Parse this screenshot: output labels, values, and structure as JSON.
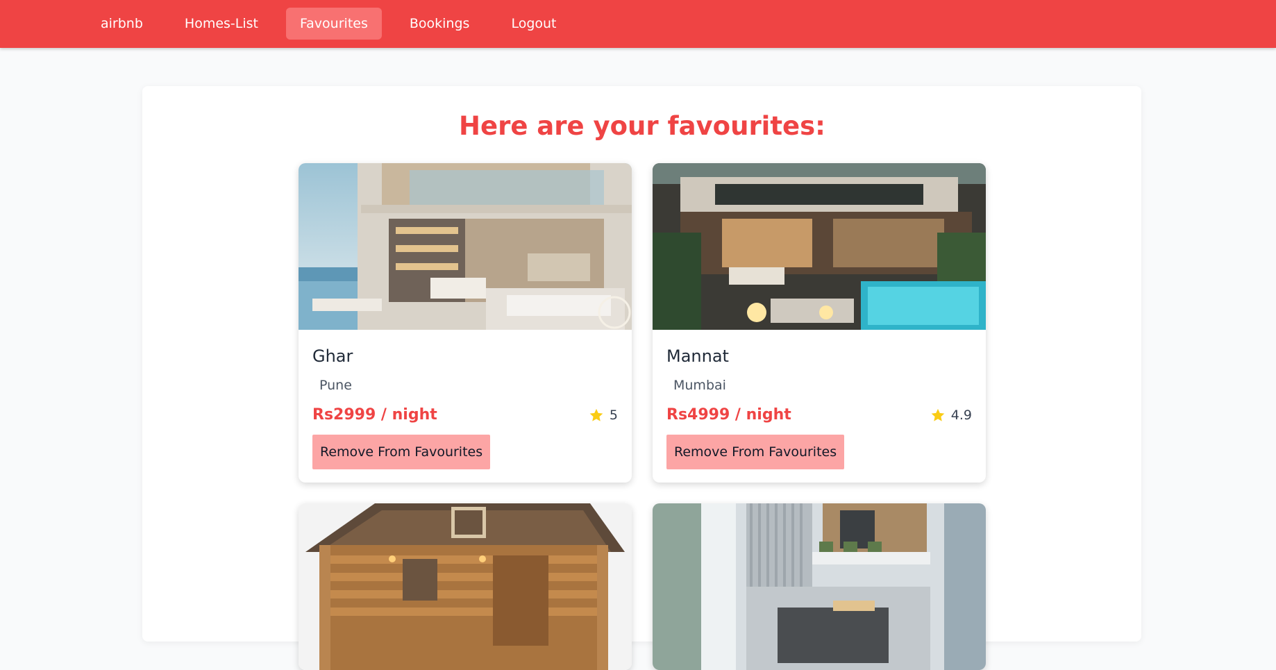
{
  "nav": {
    "items": [
      {
        "label": "airbnb",
        "active": false
      },
      {
        "label": "Homes-List",
        "active": false
      },
      {
        "label": "Favourites",
        "active": true
      },
      {
        "label": "Bookings",
        "active": false
      },
      {
        "label": "Logout",
        "active": false
      }
    ]
  },
  "page": {
    "title": "Here are your favourites:"
  },
  "favourites": [
    {
      "name": "Ghar",
      "location": "Pune",
      "price": "Rs2999 / night",
      "rating": "5",
      "remove_label": "Remove From Favourites"
    },
    {
      "name": "Mannat",
      "location": "Mumbai",
      "price": "Rs4999 / night",
      "rating": "4.9",
      "remove_label": "Remove From Favourites"
    },
    {
      "name": "",
      "location": "",
      "price": "",
      "rating": "",
      "remove_label": ""
    },
    {
      "name": "",
      "location": "",
      "price": "",
      "rating": "",
      "remove_label": ""
    }
  ],
  "colors": {
    "brand": "#ef4444",
    "nav_active": "#f87171",
    "button_bg": "#fca5a5",
    "star": "#facc15"
  }
}
